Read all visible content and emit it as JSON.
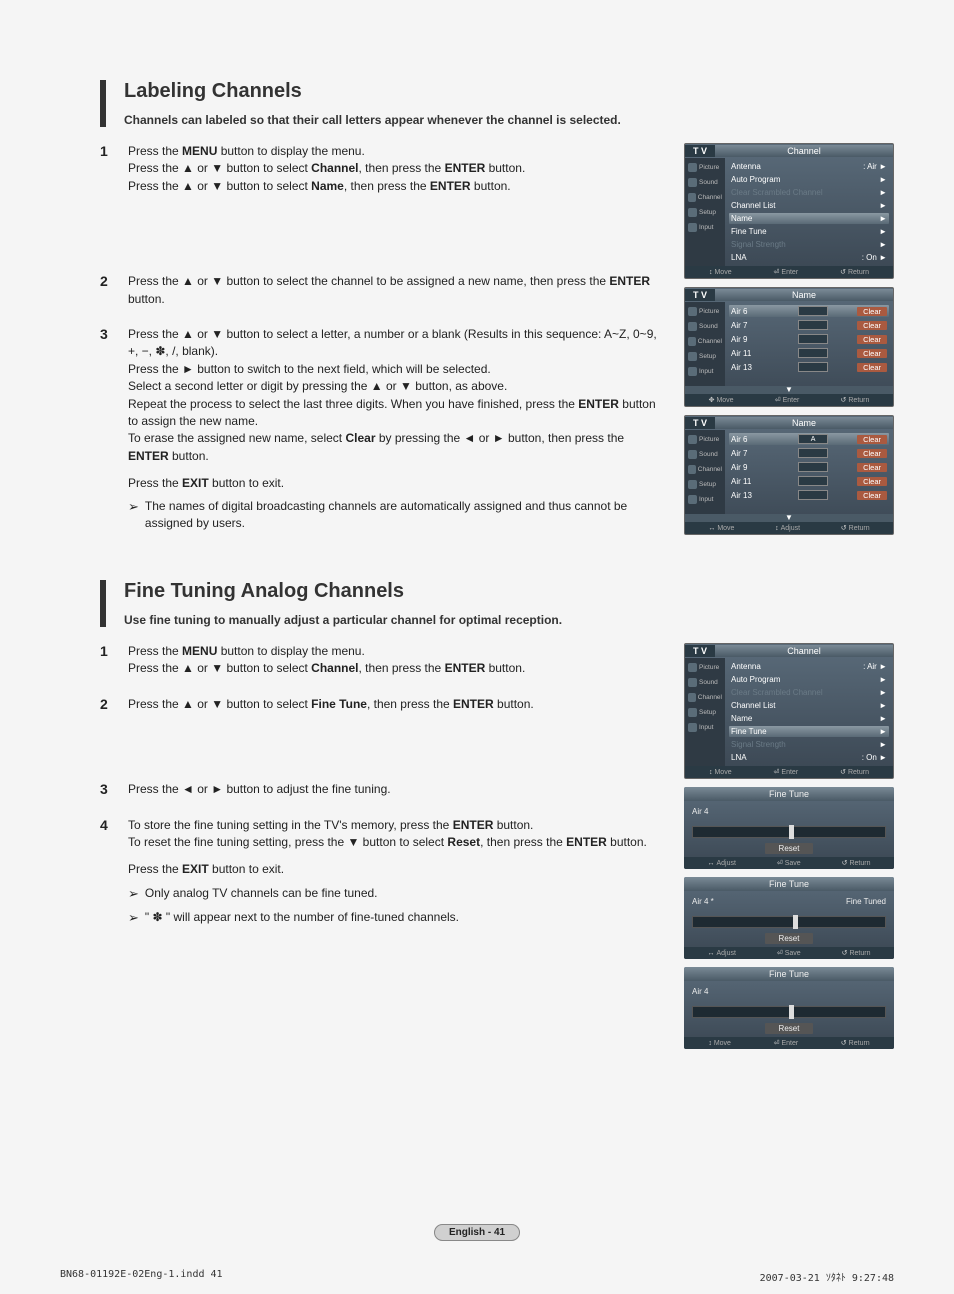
{
  "sections": {
    "labeling": {
      "title": "Labeling Channels",
      "subtitle": "Channels can labeled so that their call letters appear whenever the channel is selected."
    },
    "finetune": {
      "title": "Fine Tuning Analog Channels",
      "subtitle": "Use fine tuning to manually adjust a particular channel for optimal reception."
    }
  },
  "steps": {
    "l1a": "Press the ",
    "l1b": " button to display the menu.",
    "l1c": "Press the ▲ or ▼ button to select ",
    "l1d": ", then press the ",
    "l1e": " button.",
    "l2": "Press the ▲ or ▼ button to select the channel to be assigned a new name, then press the ",
    "l3a": "Press the ▲ or ▼ button to select a letter, a number or a blank (Results in this sequence: A~Z, 0~9, +, −, ✽, /, blank).",
    "l3b": "Press the ► button to switch to the next field, which will be selected.",
    "l3c": "Select a second letter or digit by pressing the ▲ or ▼ button, as above.",
    "l3d": "Repeat the process to select the last three digits. When you have finished, press the ",
    "l3e": " button to assign the new name.",
    "l3f": "To erase the assigned new name, select ",
    "l3g": " by pressing the ◄ or ► button, then press the ",
    "exit": "Press the ",
    "exit2": " button to exit.",
    "note1": "The names of digital broadcasting channels are automatically assigned and thus cannot be assigned by users.",
    "f2": "Press the ▲ or ▼ button to select ",
    "f3": "Press the ◄ or ► button to adjust the fine tuning.",
    "f4a": "To store the fine tuning setting in the TV's memory, press the ",
    "f4b": "To reset the fine tuning setting, press the ▼ button to select ",
    "note2": "Only analog TV channels can be fine tuned.",
    "note3": "\" ✽ \" will appear next to the number of fine-tuned channels."
  },
  "labels": {
    "menu": "MENU",
    "enter": "ENTER",
    "channel": "Channel",
    "name": "Name",
    "clear": "Clear",
    "exit": "EXIT",
    "finetune": "Fine Tune",
    "reset": "Reset"
  },
  "osd": {
    "tv": "T V",
    "side": [
      "Picture",
      "Sound",
      "Channel",
      "Setup",
      "Input"
    ],
    "channel_menu": {
      "title": "Channel",
      "items": [
        {
          "label": "Antenna",
          "value": ": Air",
          "dim": false
        },
        {
          "label": "Auto Program",
          "value": "",
          "dim": false
        },
        {
          "label": "Clear Scrambled Channel",
          "value": "",
          "dim": true
        },
        {
          "label": "Channel List",
          "value": "",
          "dim": false
        },
        {
          "label": "Name",
          "value": "",
          "dim": false,
          "hl": true
        },
        {
          "label": "Fine Tune",
          "value": "",
          "dim": false
        },
        {
          "label": "Signal Strength",
          "value": "",
          "dim": true
        },
        {
          "label": "LNA",
          "value": ": On",
          "dim": false
        }
      ],
      "foot": [
        "Move",
        "Enter",
        "Return"
      ],
      "foot_icons": [
        "↕",
        "⏎",
        "↺"
      ]
    },
    "name_menu": {
      "title": "Name",
      "rows": [
        {
          "ch": "Air 6",
          "box": "",
          "hl": true
        },
        {
          "ch": "Air 7",
          "box": ""
        },
        {
          "ch": "Air 9",
          "box": ""
        },
        {
          "ch": "Air 11",
          "box": ""
        },
        {
          "ch": "Air 13",
          "box": ""
        }
      ],
      "foot": [
        "Move",
        "Enter",
        "Return"
      ],
      "foot_icons": [
        "✥",
        "⏎",
        "↺"
      ]
    },
    "name_menu2": {
      "title": "Name",
      "rows": [
        {
          "ch": "Air 6",
          "box": "A",
          "hl": true
        },
        {
          "ch": "Air 7",
          "box": ""
        },
        {
          "ch": "Air 9",
          "box": ""
        },
        {
          "ch": "Air 11",
          "box": ""
        },
        {
          "ch": "Air 13",
          "box": ""
        }
      ],
      "foot": [
        "Move",
        "Adjust",
        "Return"
      ],
      "foot_icons": [
        "↔",
        "↕",
        "↺"
      ]
    },
    "channel_menu2": {
      "title": "Channel",
      "items": [
        {
          "label": "Antenna",
          "value": ": Air",
          "dim": false
        },
        {
          "label": "Auto Program",
          "value": "",
          "dim": false
        },
        {
          "label": "Clear Scrambled Channel",
          "value": "",
          "dim": true
        },
        {
          "label": "Channel List",
          "value": "",
          "dim": false
        },
        {
          "label": "Name",
          "value": "",
          "dim": false
        },
        {
          "label": "Fine Tune",
          "value": "",
          "dim": false,
          "hl": true
        },
        {
          "label": "Signal Strength",
          "value": "",
          "dim": true
        },
        {
          "label": "LNA",
          "value": ": On",
          "dim": false
        }
      ],
      "foot": [
        "Move",
        "Enter",
        "Return"
      ],
      "foot_icons": [
        "↕",
        "⏎",
        "↺"
      ]
    },
    "ft1": {
      "title": "Fine Tune",
      "ch": "Air  4",
      "status": "",
      "val": "0",
      "pos": 50,
      "reset": "Reset",
      "foot": [
        "Adjust",
        "Save",
        "Return"
      ],
      "foot_icons": [
        "↔",
        "⏎",
        "↺"
      ]
    },
    "ft2": {
      "title": "Fine Tune",
      "ch": "Air  4 *",
      "status": "Fine Tuned",
      "val": "10",
      "pos": 52,
      "reset": "Reset",
      "foot": [
        "Adjust",
        "Save",
        "Return"
      ],
      "foot_icons": [
        "↔",
        "⏎",
        "↺"
      ]
    },
    "ft3": {
      "title": "Fine Tune",
      "ch": "Air  4",
      "status": "",
      "val": "0",
      "pos": 50,
      "reset": "Reset",
      "foot": [
        "Move",
        "Enter",
        "Return"
      ],
      "foot_icons": [
        "↕",
        "⏎",
        "↺"
      ]
    }
  },
  "clear_label": "Clear",
  "pagefoot": "English - 41",
  "printfoot": {
    "left": "BN68-01192E-02Eng-1.indd   41",
    "right": "2007-03-21   ｿﾀﾈﾄ 9:27:48"
  }
}
